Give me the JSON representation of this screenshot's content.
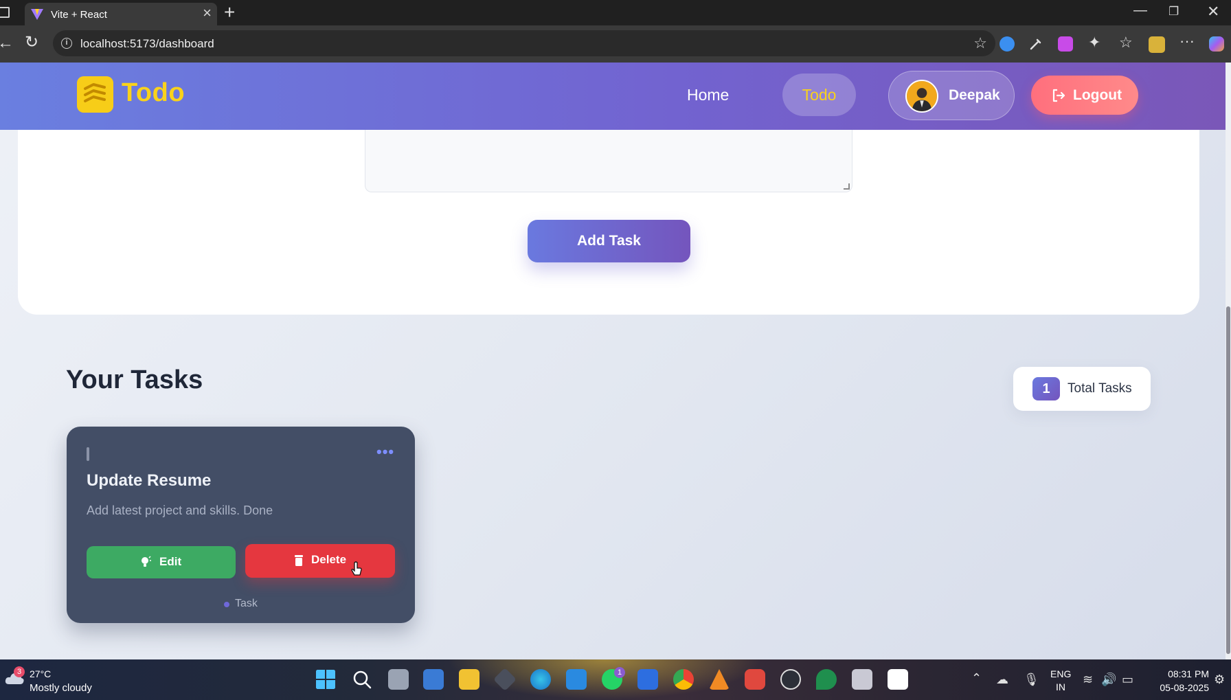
{
  "browser": {
    "tab_title": "Vite + React",
    "url": "localhost:5173/dashboard"
  },
  "navbar": {
    "brand": "Todo",
    "links": [
      "Home",
      "Todo"
    ],
    "active_link": "Todo",
    "user_name": "Deepak",
    "logout_label": "Logout"
  },
  "form": {
    "add_task_label": "Add Task"
  },
  "tasks_section": {
    "heading": "Your Tasks",
    "total_count": "1",
    "total_label": "Total Tasks",
    "tasks": [
      {
        "title": "Update Resume",
        "description": "Add latest project and skills. Done",
        "edit_label": "Edit",
        "delete_label": "Delete",
        "tag": "Task"
      }
    ]
  },
  "taskbar": {
    "weather_badge": "3",
    "temperature": "27°C",
    "weather": "Mostly cloudy",
    "whatsapp_badge": "1",
    "lang_line1": "ENG",
    "lang_line2": "IN",
    "time": "08:31 PM",
    "date": "05-08-2025"
  },
  "colors": {
    "navbar_gradient_start": "#6a7fe0",
    "navbar_gradient_end": "#7a57b8",
    "brand_yellow": "#f9d21b",
    "logout_red": "#ff6f7d",
    "edit_green": "#3daa63",
    "delete_red": "#e5373f",
    "card_bg": "#434e66"
  }
}
